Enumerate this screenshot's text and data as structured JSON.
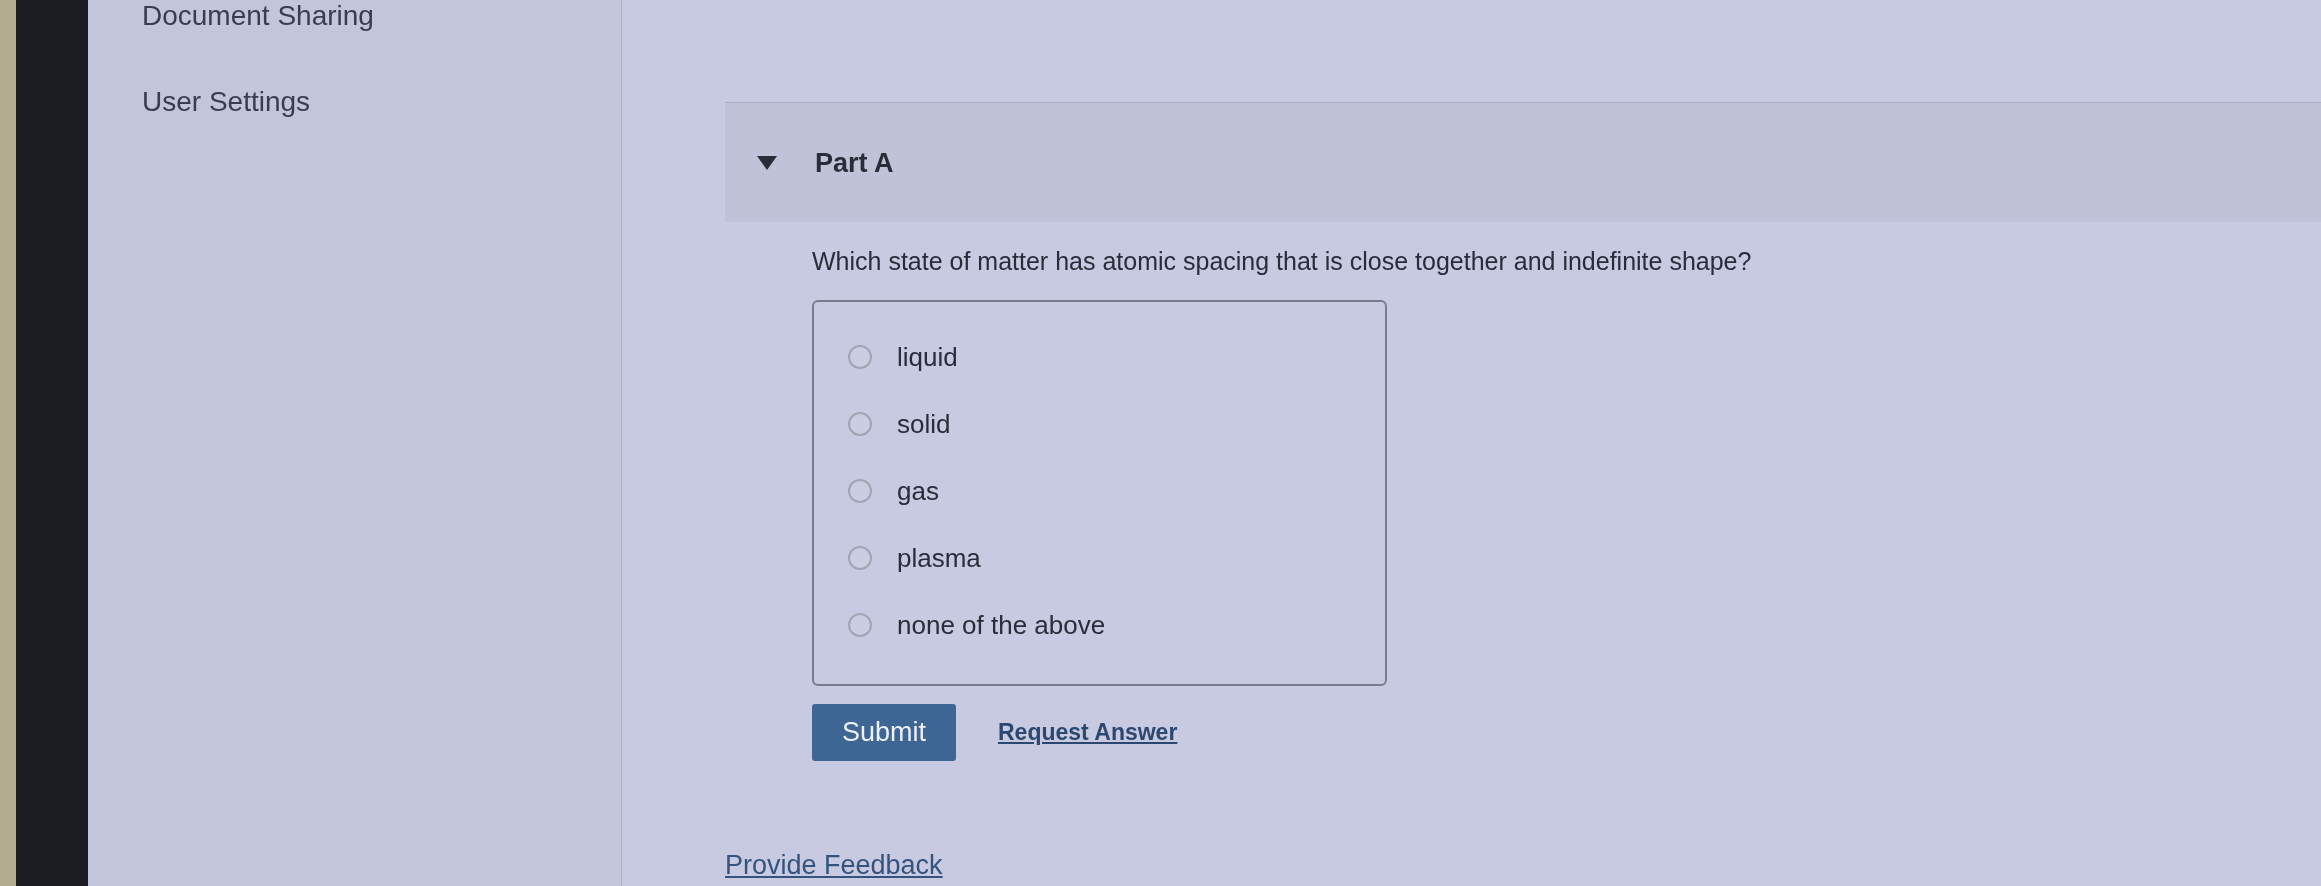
{
  "sidebar": {
    "items": [
      {
        "label": "Document Sharing"
      },
      {
        "label": "User Settings"
      }
    ]
  },
  "part": {
    "title": "Part A",
    "expanded": true
  },
  "question": {
    "text": "Which state of matter has atomic spacing that is close together and indefinite shape?",
    "options": [
      {
        "label": "liquid",
        "selected": false
      },
      {
        "label": "solid",
        "selected": false
      },
      {
        "label": "gas",
        "selected": false
      },
      {
        "label": "plasma",
        "selected": false
      },
      {
        "label": "none of the above",
        "selected": false
      }
    ]
  },
  "actions": {
    "submit": "Submit",
    "request_answer": "Request Answer"
  },
  "footer": {
    "feedback_link": "Provide Feedback"
  }
}
